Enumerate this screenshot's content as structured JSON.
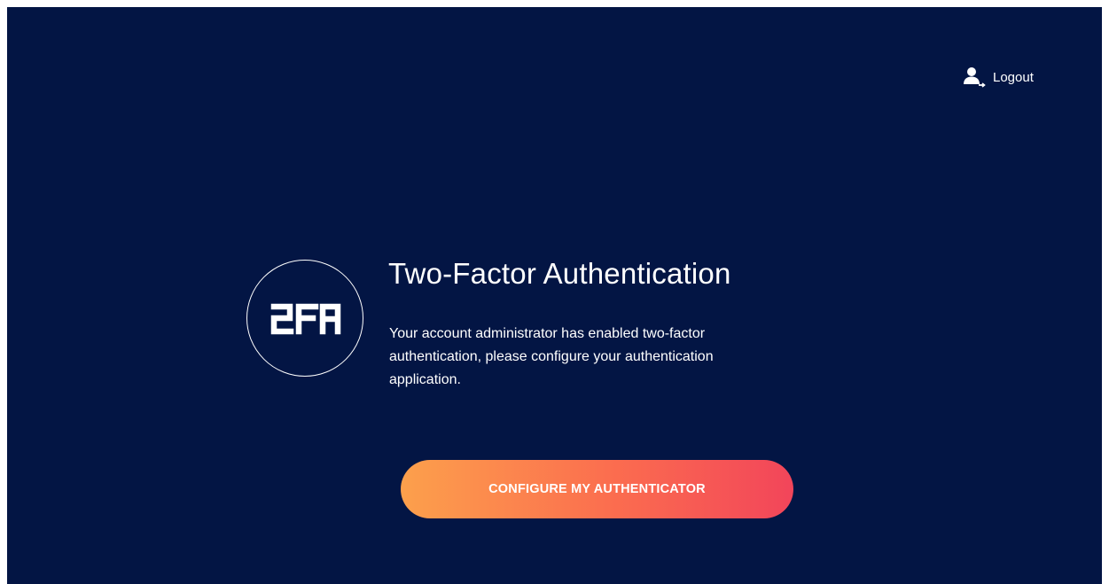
{
  "header": {
    "logout_label": "Logout",
    "logout_icon": "user-logout-icon"
  },
  "badge": {
    "icon": "2fa-badge-icon",
    "text": "2FA"
  },
  "main": {
    "title": "Two-Factor Authentication",
    "description": "Your account administrator has enabled two-factor authentication, please configure your authentication application.",
    "cta_label": "CONFIGURE MY AUTHENTICATOR"
  },
  "colors": {
    "background": "#031544",
    "text": "#ffffff",
    "button_gradient_start": "#fca04c",
    "button_gradient_end": "#f2455a"
  }
}
